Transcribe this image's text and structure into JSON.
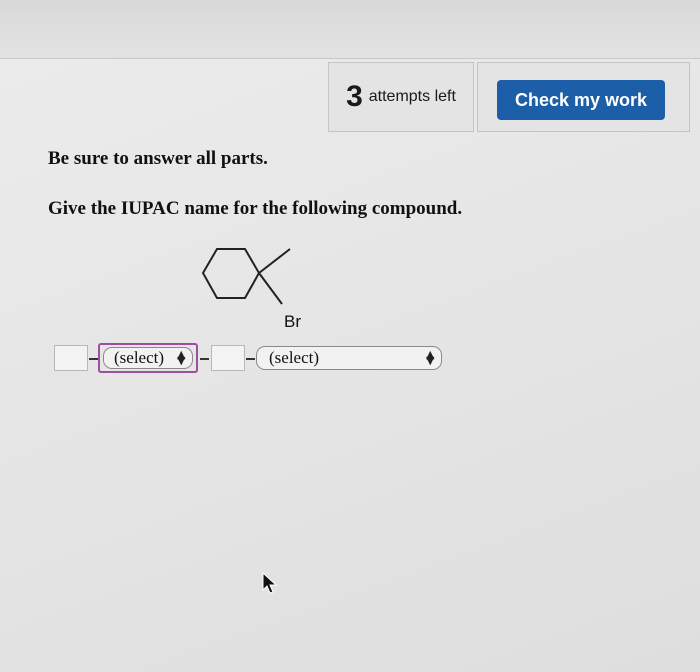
{
  "header": {
    "attempts_count": "3",
    "attempts_label": "attempts left",
    "check_button_label": "Check my work"
  },
  "question": {
    "instruction": "Be sure to answer all parts.",
    "prompt": "Give the IUPAC name for the following compound.",
    "substituent_label": "Br"
  },
  "answer": {
    "select_1_value": "(select)",
    "select_2_value": "(select)"
  },
  "icons": {
    "select_arrow": "up-down-arrow-icon",
    "cursor": "mouse-pointer-icon"
  },
  "colors": {
    "primary_button": "#1c5ea8",
    "focus_outline": "#9b4f9e"
  }
}
